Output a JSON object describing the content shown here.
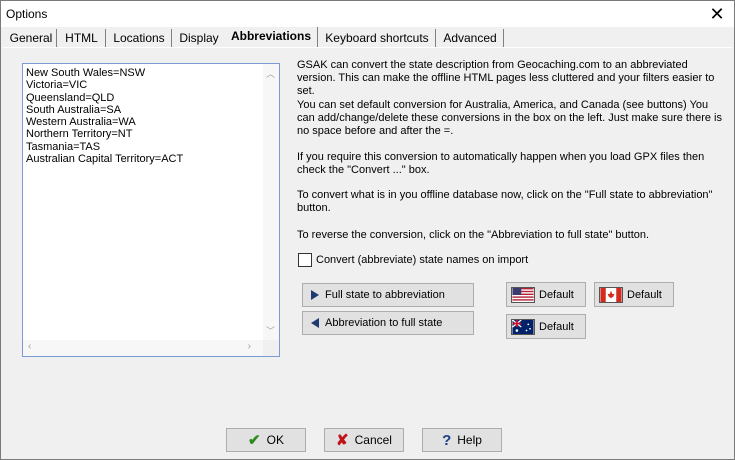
{
  "window": {
    "title": "Options"
  },
  "tabs": [
    {
      "label": "General"
    },
    {
      "label": "HTML"
    },
    {
      "label": "Locations"
    },
    {
      "label": "Display"
    },
    {
      "label": "Abbreviations",
      "active": true
    },
    {
      "label": "Keyboard shortcuts"
    },
    {
      "label": "Advanced"
    }
  ],
  "abbreviations": [
    "New South Wales=NSW",
    "Victoria=VIC",
    "Queensland=QLD",
    "South Australia=SA",
    "Western Australia=WA",
    "Northern Territory=NT",
    "Tasmania=TAS",
    "Australian Capital Territory=ACT"
  ],
  "help": {
    "p1": "GSAK can convert the state description from Geocaching.com to an abbreviated version. This can make the offline HTML pages less cluttered and your filters easier to set.",
    "p2": "You can set default conversion for Australia, America, and Canada  (see buttons) You can add/change/delete these conversions in the box on the left. Just make sure there is no space before and after the =.",
    "p3": "If you require this conversion to automatically happen when you load GPX files then check the \"Convert ...\" box.",
    "p4": "To convert what is in you offline database now, click on the \"Full state to abbreviation\" button.",
    "p5": "To reverse the conversion, click on the \"Abbreviation to full state\" button."
  },
  "convert_checkbox": {
    "label": "Convert (abbreviate) state names on import",
    "checked": false
  },
  "buttons": {
    "full_to_abbr": "Full state to abbreviation",
    "abbr_to_full": "Abbreviation to full state",
    "default_us": "Default",
    "default_ca": "Default",
    "default_au": "Default",
    "ok": "OK",
    "cancel": "Cancel",
    "help": "Help"
  },
  "icons": {
    "ok": "check-icon",
    "cancel": "x-icon",
    "help": "question-icon"
  },
  "colors": {
    "ok_icon": "#2e8b1e",
    "cancel_icon": "#c0141a",
    "help_icon": "#1a3f8a",
    "arrow": "#1f3a6e"
  }
}
